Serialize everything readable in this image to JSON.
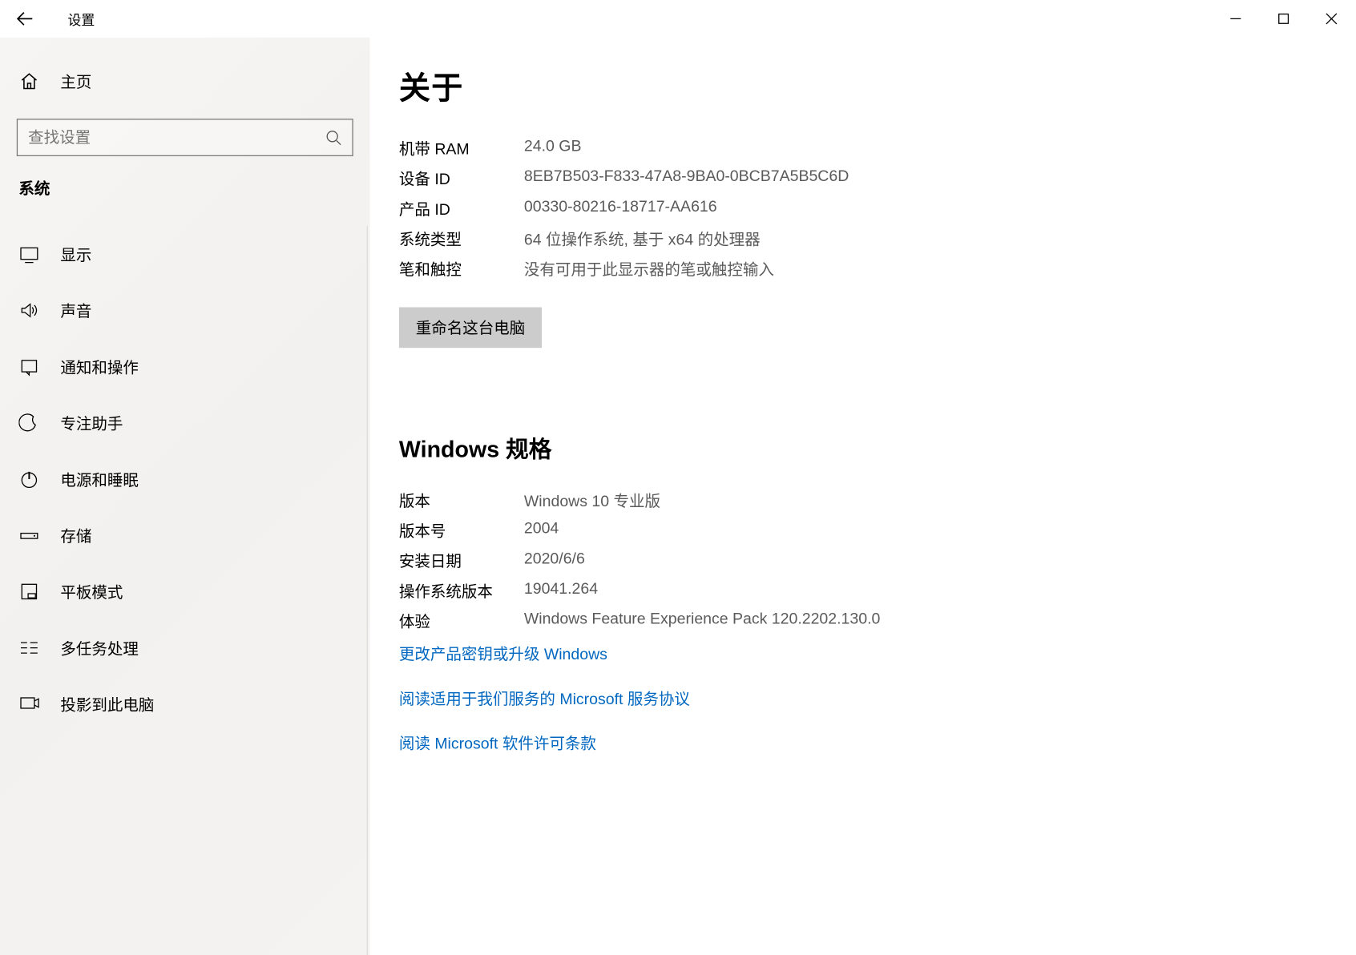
{
  "window": {
    "title": "设置"
  },
  "sidebar": {
    "home": "主页",
    "search_placeholder": "查找设置",
    "category": "系统",
    "items": [
      {
        "icon": "display-icon",
        "label": "显示"
      },
      {
        "icon": "sound-icon",
        "label": "声音"
      },
      {
        "icon": "notifications-icon",
        "label": "通知和操作"
      },
      {
        "icon": "focus-assist-icon",
        "label": "专注助手"
      },
      {
        "icon": "power-icon",
        "label": "电源和睡眠"
      },
      {
        "icon": "storage-icon",
        "label": "存储"
      },
      {
        "icon": "tablet-icon",
        "label": "平板模式"
      },
      {
        "icon": "multitask-icon",
        "label": "多任务处理"
      },
      {
        "icon": "project-icon",
        "label": "投影到此电脑"
      }
    ]
  },
  "main": {
    "title": "关于",
    "device_specs": [
      {
        "label": "机带 RAM",
        "value": "24.0 GB"
      },
      {
        "label": "设备 ID",
        "value": "8EB7B503-F833-47A8-9BA0-0BCB7A5B5C6D"
      },
      {
        "label": "产品 ID",
        "value": "00330-80216-18717-AA616"
      },
      {
        "label": "系统类型",
        "value": "64 位操作系统, 基于 x64 的处理器"
      },
      {
        "label": "笔和触控",
        "value": "没有可用于此显示器的笔或触控输入"
      }
    ],
    "rename_button": "重命名这台电脑",
    "win_section_title": "Windows 规格",
    "win_specs": [
      {
        "label": "版本",
        "value": "Windows 10 专业版"
      },
      {
        "label": "版本号",
        "value": "2004"
      },
      {
        "label": "安装日期",
        "value": "2020/6/6"
      },
      {
        "label": "操作系统版本",
        "value": "19041.264"
      },
      {
        "label": "体验",
        "value": "Windows Feature Experience Pack 120.2202.130.0"
      }
    ],
    "links": [
      "更改产品密钥或升级 Windows",
      "阅读适用于我们服务的 Microsoft 服务协议",
      "阅读 Microsoft 软件许可条款"
    ]
  }
}
